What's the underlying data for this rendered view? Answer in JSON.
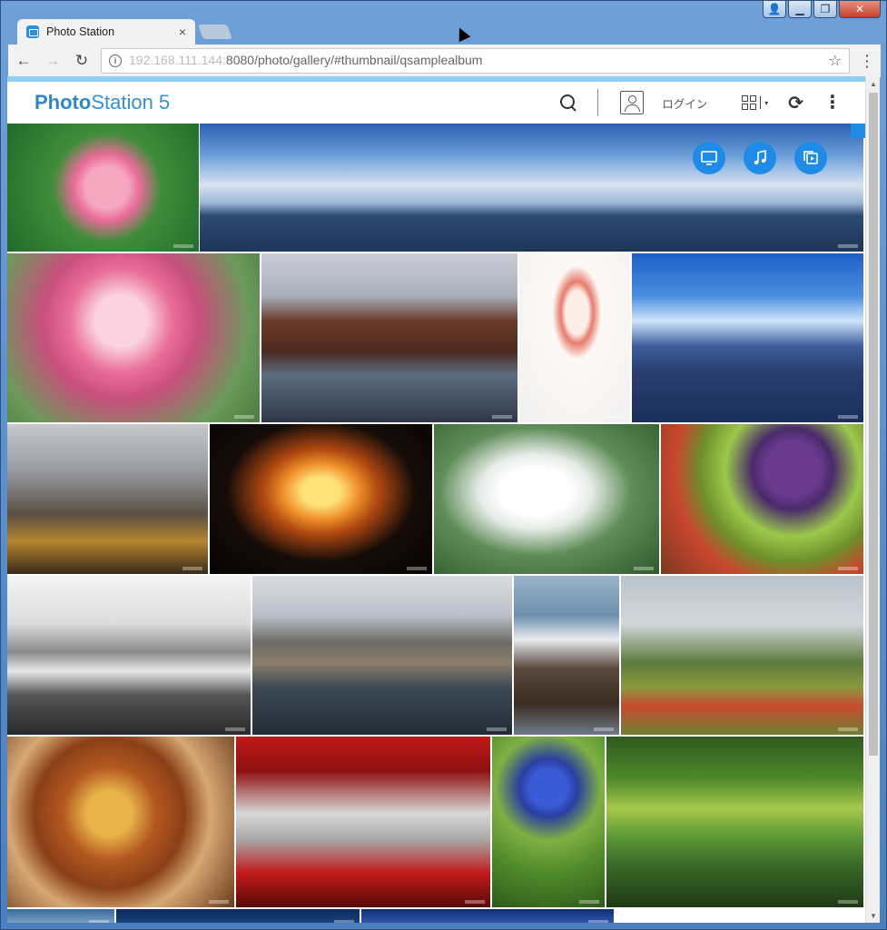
{
  "window": {
    "controls": {
      "user": "👤",
      "minimize": "▁",
      "maximize": "❐",
      "close": "✕"
    }
  },
  "browser": {
    "tab": {
      "title": "Photo Station",
      "close": "×"
    },
    "nav": {
      "back": "←",
      "forward": "→",
      "reload": "↻"
    },
    "url": {
      "host": "192.168.111.144:",
      "path": "8080/photo/gallery/#thumbnail/qsamplealbum"
    },
    "star": "☆",
    "menu": "⋮"
  },
  "app": {
    "logo_bold": "Photo",
    "logo_rest": "Station 5",
    "login_label": "ログイン",
    "refresh": "⟳",
    "more": "⋮",
    "caret": "▾"
  },
  "colors": {
    "accent": "#1e8be6",
    "logo": "#3a8fd0",
    "header_strip": "#8fd0f0"
  },
  "scrollbar": {
    "up": "▲",
    "down": "▼"
  },
  "photos": [
    {
      "name": "pink-rose",
      "bg": "radial-gradient(circle at 52% 50%, #f7a6c0 0 18%, #e86c98 28%, #3f8d3a 46%, #1f6b2a 100%)"
    },
    {
      "name": "coastal-panorama",
      "bg": "linear-gradient(#2a5fb0 0%, #6c9fd8 25%, #d8e3f0 48%, #9bb6d4 62%, #2c4a72 72%, #1f3656 100%)"
    },
    {
      "name": "cherry-blossom",
      "bg": "radial-gradient(circle at 45% 40%, #fbd3e0 0 15%, #e96f9a 30%, #c94f7d 45%, #6a9a5a 75%, #4b7a3f 100%)"
    },
    {
      "name": "brick-warehouse-canal",
      "bg": "linear-gradient(#c9ccd4 0%, #aab0bc 25%, #6b3b2c 40%, #4d2a20 58%, #5d6c80 72%, #2e3746 100%)"
    },
    {
      "name": "ice-cream-cone",
      "bg": "radial-gradient(ellipse at 52% 35%, #fbeee8 0 14%, #e77c6c 20%, #fdf8f5 30%, #f1f1f1 100%), linear-gradient(#eee,#ddd)"
    },
    {
      "name": "overwater-bungalows",
      "bg": "linear-gradient(#1f5fc9 0%, #4a8ee0 25%, #cfe4fb 40%, #3d5e9c 55%, #2a3e70 70%, #1b2e5a 100%)"
    },
    {
      "name": "rainy-window-city",
      "bg": "linear-gradient(#c7c8cc 0%, #9a9ca3 30%, #5a5045 60%, #b5852f 78%, #3a2a18 100%)"
    },
    {
      "name": "night-carousel",
      "bg": "radial-gradient(ellipse at 50% 45%, #ffe27a 0 12%, #f0902a 24%, #b34a10 36%, #150c08 60%, #050302 100%)"
    },
    {
      "name": "white-cyclamen",
      "bg": "radial-gradient(ellipse at 45% 45%, #ffffff 0 20%, #e6ece7 32%, #5f8c58 55%, #2f5a2c 100%)"
    },
    {
      "name": "grilled-vegetables",
      "bg": "radial-gradient(circle at 65% 30%, #6a3a8f 0 16%, #4a2a6a 24%, #9bc94b 40%, #6e8f2a 55%, #c9462e 70%, #7a3a1f 100%)"
    },
    {
      "name": "mono-seascape",
      "bg": "linear-gradient(#f4f4f4 0%, #dcdcdc 30%, #8a8a8a 48%, #e8e8e8 60%, #555 75%, #2b2b2b 100%)"
    },
    {
      "name": "otaru-canal",
      "bg": "linear-gradient(#d9dde2 0%, #b9c0c8 25%, #6d6a64 42%, #8b7d6b 55%, #3d4a55 70%, #222c35 100%)"
    },
    {
      "name": "rock-shore-long-exposure",
      "bg": "linear-gradient(#9ab4c9 0%, #6d8fad 25%, #e9ecef 40%, #5b4a3f 58%, #3a2c22 80%, #6c7a85 100%)"
    },
    {
      "name": "red-tractor-field",
      "bg": "linear-gradient(#b9c4cc 0%, #d2d7db 30%, #5b7a3a 55%, #8a9a3f 70%, #c94a30 82%, #6d7f32 100%)"
    },
    {
      "name": "curry-rosemary",
      "bg": "radial-gradient(circle at 45% 45%, #e9b54a 0 14%, #b2581f 30%, #8a3f17 48%, #d6a873 65%, #6a3a1a 100%)"
    },
    {
      "name": "race-car",
      "bg": "linear-gradient(#c21a1a 0%, #8f1010 20%, #d7d7d7 45%, #a9a9a9 60%, #c21a1a 80%, #5a0a0a 100%)"
    },
    {
      "name": "blue-agapanthus",
      "bg": "radial-gradient(circle at 50% 30%, #3a5bd6 0 14%, #2a3fa0 22%, #7fb043 40%, #4f8a2a 65%, #2f5a1a 100%)"
    },
    {
      "name": "mossy-trees-pond",
      "bg": "linear-gradient(#2f5a20 0%, #4f8a2a 25%, #a6c94a 42%, #5f9a38 58%, #3a6a28 75%, #1f3a14 100%)"
    },
    {
      "name": "bottom-row-1",
      "bg": "linear-gradient(#3a6a9a, #8bb0d0)"
    },
    {
      "name": "bottom-row-2",
      "bg": "linear-gradient(#0c2a5a, #1f4a8a)"
    },
    {
      "name": "bottom-row-3",
      "bg": "linear-gradient(#0e2d78, #3a63b8)"
    }
  ]
}
